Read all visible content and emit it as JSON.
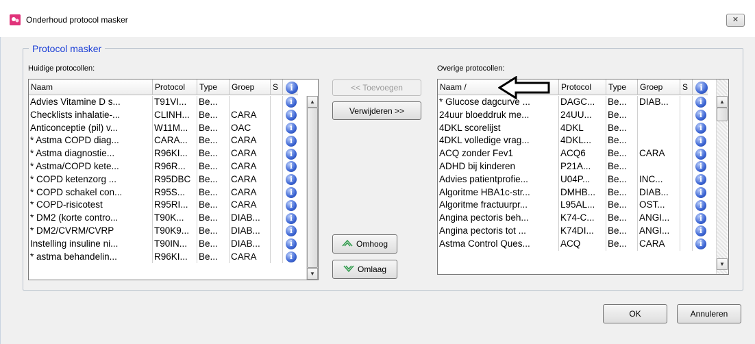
{
  "window": {
    "title": "Onderhoud protocol masker",
    "close_glyph": "✕",
    "app_icon": "app-logo-icon"
  },
  "groupbox": {
    "title": "Protocol masker"
  },
  "current": {
    "label": "Huidige protocollen:",
    "columns": [
      "Naam",
      "Protocol",
      "Type",
      "Groep",
      "S"
    ],
    "rows": [
      {
        "naam": "Advies Vitamine D s...",
        "protocol": "T91VI...",
        "type": "Be...",
        "groep": "",
        "s": ""
      },
      {
        "naam": "Checklists inhalatie-...",
        "protocol": "CLINH...",
        "type": "Be...",
        "groep": "CARA",
        "s": ""
      },
      {
        "naam": "Anticonceptie (pil) v...",
        "protocol": "W11M...",
        "type": "Be...",
        "groep": "OAC",
        "s": ""
      },
      {
        "naam": "* Astma COPD diag...",
        "protocol": "CARA...",
        "type": "Be...",
        "groep": "CARA",
        "s": ""
      },
      {
        "naam": "* Astma diagnostie...",
        "protocol": "R96KI...",
        "type": "Be...",
        "groep": "CARA",
        "s": ""
      },
      {
        "naam": "* Astma/COPD kete...",
        "protocol": "R96R...",
        "type": "Be...",
        "groep": "CARA",
        "s": ""
      },
      {
        "naam": "* COPD ketenzorg ...",
        "protocol": "R95DBC",
        "type": "Be...",
        "groep": "CARA",
        "s": ""
      },
      {
        "naam": "* COPD schakel con...",
        "protocol": "R95S...",
        "type": "Be...",
        "groep": "CARA",
        "s": ""
      },
      {
        "naam": "* COPD-risicotest",
        "protocol": "R95RI...",
        "type": "Be...",
        "groep": "CARA",
        "s": ""
      },
      {
        "naam": "* DM2 (korte contro...",
        "protocol": "T90K...",
        "type": "Be...",
        "groep": "DIAB...",
        "s": ""
      },
      {
        "naam": "* DM2/CVRM/CVRP",
        "protocol": "T90K9...",
        "type": "Be...",
        "groep": "DIAB...",
        "s": ""
      },
      {
        "naam": "Instelling insuline ni...",
        "protocol": "T90IN...",
        "type": "Be...",
        "groep": "DIAB...",
        "s": ""
      },
      {
        "naam": "* astma behandelin...",
        "protocol": "R96KI...",
        "type": "Be...",
        "groep": "CARA",
        "s": ""
      }
    ]
  },
  "other": {
    "label": "Overige protocollen:",
    "columns": [
      "Naam /",
      "Protocol",
      "Type",
      "Groep",
      "S"
    ],
    "rows": [
      {
        "naam": "* Glucose dagcurve ...",
        "protocol": "DAGC...",
        "type": "Be...",
        "groep": "DIAB...",
        "s": ""
      },
      {
        "naam": "24uur bloeddruk me...",
        "protocol": "24UU...",
        "type": "Be...",
        "groep": "",
        "s": ""
      },
      {
        "naam": "4DKL scorelijst",
        "protocol": "4DKL",
        "type": "Be...",
        "groep": "",
        "s": ""
      },
      {
        "naam": "4DKL volledige vrag...",
        "protocol": "4DKL...",
        "type": "Be...",
        "groep": "",
        "s": ""
      },
      {
        "naam": "ACQ zonder Fev1",
        "protocol": "ACQ6",
        "type": "Be...",
        "groep": "CARA",
        "s": ""
      },
      {
        "naam": "ADHD bij kinderen",
        "protocol": "P21A...",
        "type": "Be...",
        "groep": "",
        "s": ""
      },
      {
        "naam": "Advies patientprofie...",
        "protocol": "U04P...",
        "type": "Be...",
        "groep": "INC...",
        "s": ""
      },
      {
        "naam": "Algoritme HBA1c-str...",
        "protocol": "DMHB...",
        "type": "Be...",
        "groep": "DIAB...",
        "s": ""
      },
      {
        "naam": "Algoritme fractuurpr...",
        "protocol": "L95AL...",
        "type": "Be...",
        "groep": "OST...",
        "s": ""
      },
      {
        "naam": "Angina pectoris beh...",
        "protocol": "K74-C...",
        "type": "Be...",
        "groep": "ANGI...",
        "s": ""
      },
      {
        "naam": "Angina pectoris tot ...",
        "protocol": "K74DI...",
        "type": "Be...",
        "groep": "ANGI...",
        "s": ""
      },
      {
        "naam": "Astma Control Ques...",
        "protocol": "ACQ",
        "type": "Be...",
        "groep": "CARA",
        "s": ""
      }
    ]
  },
  "buttons": {
    "add_label": "<< Toevoegen",
    "remove_label": "Verwijderen >>",
    "up_label": "Omhoog",
    "down_label": "Omlaag",
    "ok_label": "OK",
    "cancel_label": "Annuleren"
  },
  "icons": {
    "info": "info-icon",
    "info_glyph": "i",
    "scroll_up_glyph": "▲",
    "scroll_down_glyph": "▼"
  },
  "colors": {
    "group_title": "#1c3fd6",
    "omhoog_icon": "#2e9a4a",
    "omlaag_icon": "#2e9a4a",
    "info_icon": "#3d66d4"
  }
}
